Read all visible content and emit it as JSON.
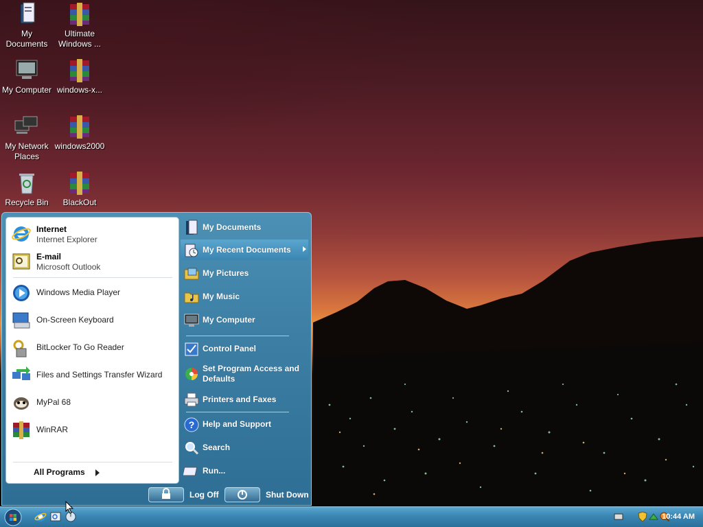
{
  "desktop": {
    "icons": [
      {
        "label": "My\nDocuments"
      },
      {
        "label": "Ultimate\nWindows ..."
      },
      {
        "label": "My Computer"
      },
      {
        "label": "windows-x..."
      },
      {
        "label": "My Network\nPlaces"
      },
      {
        "label": "windows2000"
      },
      {
        "label": "Recycle Bin"
      },
      {
        "label": "BlackOut"
      }
    ]
  },
  "start_menu": {
    "pinned": [
      {
        "title": "Internet",
        "subtitle": "Internet Explorer",
        "icon": "internet-explorer-icon"
      },
      {
        "title": "E-mail",
        "subtitle": "Microsoft Outlook",
        "icon": "outlook-icon"
      }
    ],
    "recent": [
      {
        "label": "Windows Media Player",
        "icon": "media-player-icon"
      },
      {
        "label": "On-Screen Keyboard",
        "icon": "keyboard-icon"
      },
      {
        "label": "BitLocker To Go Reader",
        "icon": "bitlocker-icon"
      },
      {
        "label": "Files and Settings Transfer Wizard",
        "icon": "transfer-wizard-icon"
      },
      {
        "label": "MyPal 68",
        "icon": "mypal-icon"
      },
      {
        "label": "WinRAR",
        "icon": "winrar-icon"
      }
    ],
    "all_programs": "All Programs",
    "right": {
      "my_documents": "My Documents",
      "my_recent_documents": "My Recent Documents",
      "my_pictures": "My Pictures",
      "my_music": "My Music",
      "my_computer": "My Computer",
      "control_panel": "Control Panel",
      "set_program_access": "Set Program Access and Defaults",
      "printers_faxes": "Printers and Faxes",
      "help_support": "Help and Support",
      "search": "Search",
      "run": "Run..."
    },
    "log_off": "Log Off",
    "shut_down": "Shut Down"
  },
  "taskbar": {
    "clock": "10:44 AM"
  },
  "colors": {
    "taskbar": "#3a86b4",
    "menu_blue": "#3d7fa5",
    "highlight": "#5aa6cf"
  }
}
